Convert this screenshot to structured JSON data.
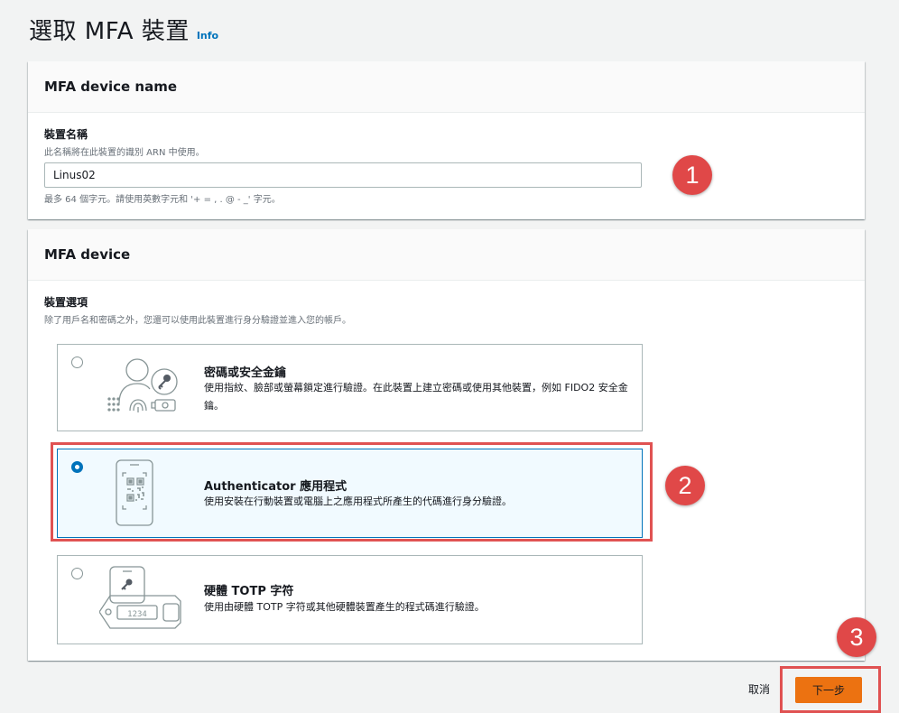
{
  "page": {
    "title": "選取 MFA 裝置",
    "info_label": "Info"
  },
  "name_section": {
    "heading": "MFA device name",
    "label": "裝置名稱",
    "description": "此名稱將在此裝置的識別 ARN 中使用。",
    "value": "Linus02",
    "constraint": "最多 64 個字元。請使用英數字元和 '+ = , . @ - _' 字元。"
  },
  "device_section": {
    "heading": "MFA device",
    "label": "裝置選項",
    "description": "除了用戶名和密碼之外，您還可以使用此裝置進行身分驗證並進入您的帳戶。",
    "options": [
      {
        "title": "密碼或安全金鑰",
        "description": "使用指紋、臉部或螢幕鎖定進行驗證。在此裝置上建立密碼或使用其他裝置，例如 FIDO2 安全金鑰。",
        "selected": false,
        "icon": "passkey-icon"
      },
      {
        "title": "Authenticator 應用程式",
        "description": "使用安裝在行動裝置或電腦上之應用程式所產生的代碼進行身分驗證。",
        "selected": true,
        "icon": "authenticator-app-icon"
      },
      {
        "title": "硬體 TOTP 字符",
        "description": "使用由硬體 TOTP 字符或其他硬體裝置產生的程式碼進行驗證。",
        "selected": false,
        "icon": "hardware-token-icon",
        "token_display": "1234"
      }
    ]
  },
  "footer": {
    "cancel_label": "取消",
    "next_label": "下一步"
  },
  "annotations": {
    "badges": [
      "1",
      "2",
      "3"
    ],
    "color": "#e04848"
  },
  "colors": {
    "accent": "#0073bb",
    "primary_button": "#ec7211",
    "selected_bg": "#f1faff"
  }
}
